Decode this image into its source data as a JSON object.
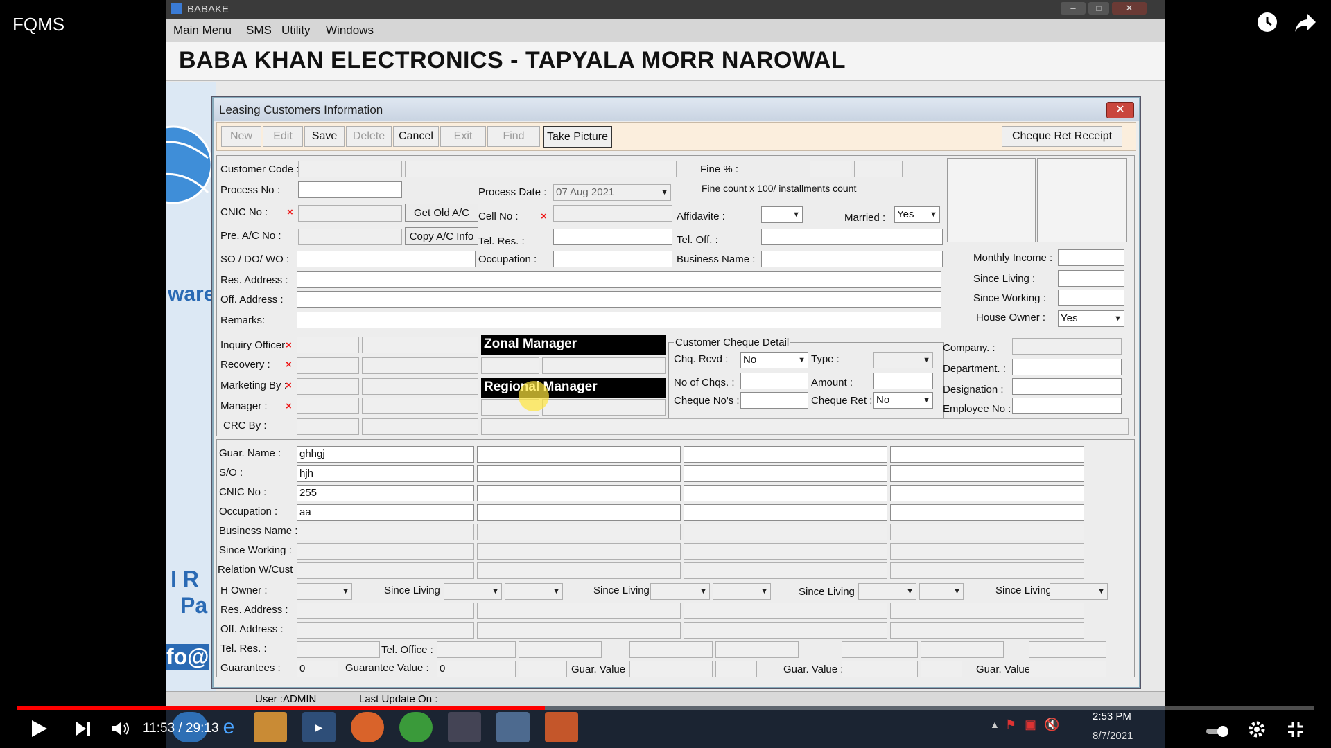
{
  "player": {
    "title": "FQMS",
    "time_current": "11:53",
    "time_sep": " / ",
    "time_total": "29:13",
    "progress_fraction": 0.407
  },
  "app": {
    "window_title": "BABAKE",
    "menu": [
      "Main Menu",
      "SMS",
      "Utility",
      "Windows"
    ],
    "banner": "BABA KHAN ELECTRONICS - TAPYALA MORR NAROWAL",
    "bg_text": [
      "ware",
      "I R",
      "Pa",
      "fo@"
    ]
  },
  "dialog": {
    "title": "Leasing Customers Information",
    "toolbar": [
      {
        "label": "New",
        "enabled": false
      },
      {
        "label": "Edit",
        "enabled": false
      },
      {
        "label": "Save",
        "enabled": true
      },
      {
        "label": "Delete",
        "enabled": false
      },
      {
        "label": "Cancel",
        "enabled": true
      },
      {
        "label": "Exit",
        "enabled": false
      },
      {
        "label": "Find",
        "enabled": false
      },
      {
        "label": "Take Picture",
        "enabled": true
      }
    ],
    "cheque_ret_receipt": "Cheque Ret Receipt",
    "labels": {
      "customer_code": "Customer Code :",
      "process_no": "Process No :",
      "cnic_no": "CNIC No :",
      "pre_ac_no": "Pre. A/C No :",
      "so_do_wo": "SO / DO/ WO :",
      "res_address": "Res. Address :",
      "off_address": "Off. Address :",
      "remarks": "Remarks:",
      "process_date": "Process Date :",
      "cell_no": "Cell No :",
      "tel_res": "Tel. Res. :",
      "occupation": "Occupation :",
      "fine_pct": "Fine % :",
      "fine_note": "Fine count x 100/ installments count",
      "affidavite": "Affidavite :",
      "married": "Married :",
      "tel_off": "Tel. Off. :",
      "business_name": "Business Name :",
      "monthly_income": "Monthly Income :",
      "since_living": "Since Living :",
      "since_working": "Since Working :",
      "house_owner": "House Owner :",
      "inquiry_officer": "Inquiry Officer",
      "recovery": "Recovery :",
      "marketing_by": "Marketing By :",
      "manager": "Manager :",
      "crc_by": "CRC By :",
      "zonal_manager": "Zonal Manager",
      "regional_manager": "Regional Manager",
      "cheque_group": "Customer Cheque Detail",
      "chq_rcvd": "Chq. Rcvd :",
      "type": "Type :",
      "no_of_chqs": "No of Chqs. :",
      "amount": "Amount :",
      "cheque_nos": "Cheque No's :",
      "cheque_ret": "Cheque Ret :",
      "company": "Company. :",
      "department": "Department. :",
      "designation": "Designation :",
      "employee_no": "Employee No :",
      "get_old_ac": "Get Old A/C",
      "copy_ac_info": "Copy A/C Info"
    },
    "values": {
      "process_date": "07 Aug 2021",
      "married": "Yes",
      "house_owner": "Yes",
      "chq_rcvd": "No",
      "cheque_ret": "No"
    },
    "guarantor": {
      "labels": [
        "Guar. Name :",
        "S/O :",
        "CNIC No :",
        "Occupation :",
        "Business Name :",
        "Since Working :",
        "Relation W/Cust"
      ],
      "values": [
        "ghhgj",
        "hjh",
        "255",
        "aa",
        "",
        "",
        ""
      ],
      "h_owner": "H Owner :",
      "since_living": "Since Living :",
      "res_address": "Res. Address :",
      "off_address": "Off. Address :",
      "tel_res": "Tel. Res. :",
      "tel_office": "Tel. Office :",
      "guarantees": "Guarantees :",
      "guarantees_val": "0",
      "guarantee_value": "Guarantee Value :",
      "guarantee_value_val": "0",
      "guar_value": "Guar. Value :"
    }
  },
  "statusbar": {
    "user": "User :ADMIN",
    "last_update": "Last Update On :"
  },
  "taskbar": {
    "time": "2:53 PM",
    "date": "8/7/2021"
  }
}
